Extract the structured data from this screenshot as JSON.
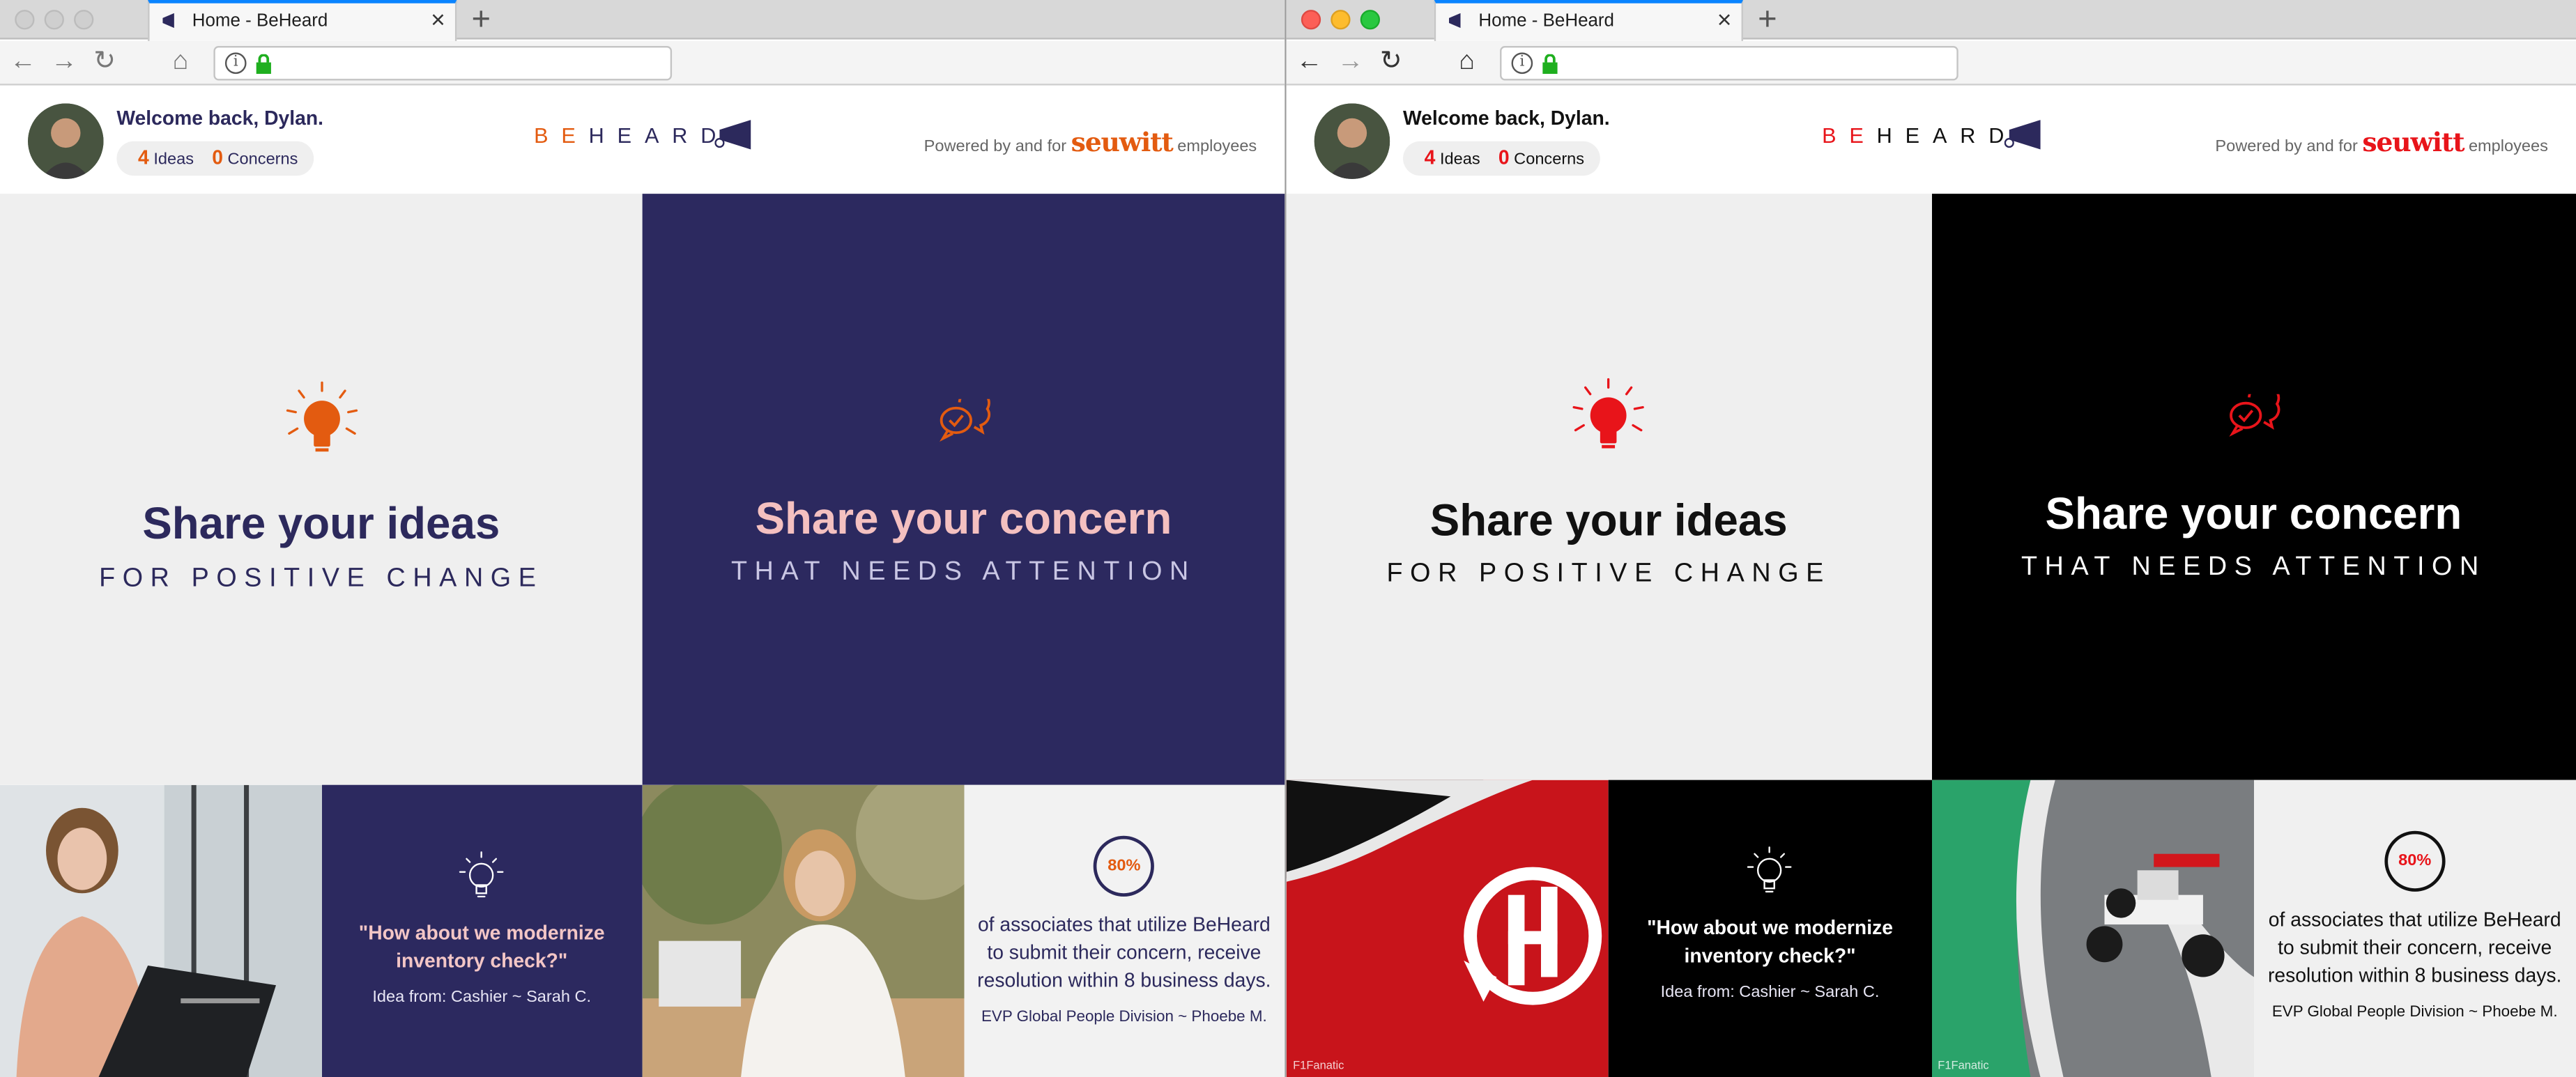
{
  "windows": [
    {
      "tab_title": "Home - BeHeard",
      "user": {
        "welcome": "Welcome back, Dylan.",
        "ideas_count": "4",
        "ideas_label": "Ideas",
        "concerns_count": "0",
        "concerns_label": "Concerns"
      },
      "logo": {
        "be": "BE",
        "heard": "HEARD"
      },
      "powered": {
        "prefix": "Powered by and for",
        "brand": "seuwitt",
        "suffix": "employees"
      },
      "hero": {
        "ideas_title": "Share your ideas",
        "ideas_sub": "FOR POSITIVE CHANGE",
        "concern_title": "Share your concern",
        "concern_sub": "THAT NEEDS ATTENTION"
      },
      "quote": {
        "text": "\"How about we modernize inventory check?\"",
        "attribution": "Idea from: Cashier ~ Sarah C."
      },
      "stat": {
        "percent": "80%",
        "text": "of associates that utilize BeHeard to submit their concern, receive resolution within 8 business days.",
        "attribution": "EVP Global People Division ~ Phoebe M."
      },
      "photos": {
        "left": "woman-with-laptop-photo",
        "right": "woman-writing-photo"
      },
      "accent": "#e35b10"
    },
    {
      "tab_title": "Home - BeHeard",
      "user": {
        "welcome": "Welcome back, Dylan.",
        "ideas_count": "4",
        "ideas_label": "Ideas",
        "concerns_count": "0",
        "concerns_label": "Concerns"
      },
      "logo": {
        "be": "BE",
        "heard": "HEARD"
      },
      "powered": {
        "prefix": "Powered by and for",
        "brand": "seuwitt",
        "suffix": "employees"
      },
      "hero": {
        "ideas_title": "Share your ideas",
        "ideas_sub": "FOR POSITIVE CHANGE",
        "concern_title": "Share your concern",
        "concern_sub": "THAT NEEDS ATTENTION"
      },
      "quote": {
        "text": "\"How about we modernize inventory check?\"",
        "attribution": "Idea from: Cashier ~ Sarah C."
      },
      "stat": {
        "percent": "80%",
        "text": "of associates that utilize BeHeard to submit their concern, receive resolution within 8 business days.",
        "attribution": "EVP Global People Division ~ Phoebe M."
      },
      "photos": {
        "left": "red-team-logo-photo",
        "right": "f1-race-car-photo",
        "watermark": "F1Fanatic"
      },
      "accent": "#e8141a"
    }
  ]
}
